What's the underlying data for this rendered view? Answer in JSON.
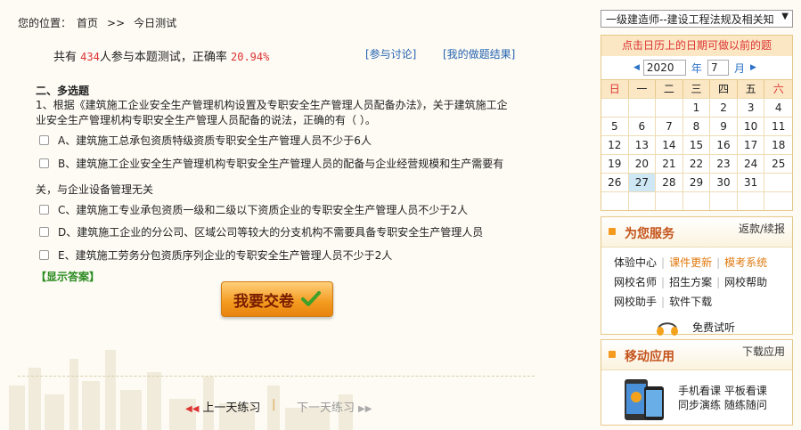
{
  "breadcrumb": {
    "prefix": "您的位置：",
    "home": "首页",
    "sep": ">>",
    "current": "今日测试"
  },
  "stats": {
    "part1": "共有",
    "count": "434",
    "part2": "人参与本题测试，正确率",
    "rate": "20.94%"
  },
  "links": {
    "discuss": "[参与讨论]",
    "result": "[我的做题结果]"
  },
  "question": {
    "section": "二、多选题",
    "text": "1、根据《建筑施工企业安全生产管理机构设置及专职安全生产管理人员配备办法》，关于建筑施工企业安全生产管理机构专职安全生产管理人员配备的说法，正确的有（   ）。",
    "options": [
      "A、建筑施工总承包资质特级资质专职安全生产管理人员不少于6人",
      "B、建筑施工企业安全生产管理机构专职安全生产管理人员的配备与企业经营规模和生产需要有",
      "C、建筑施工专业承包资质一级和二级以下资质企业的专职安全生产管理人员不少于2人",
      "D、建筑施工企业的分公司、区域公司等较大的分支机构不需要具备专职安全生产管理人员",
      "E、建筑施工劳务分包资质序列企业的专职安全生产管理人员不少于2人"
    ],
    "option_b_wrap": "关，与企业设备管理无关",
    "show_answer": "【显示答案】"
  },
  "submit": {
    "label": "我要交卷"
  },
  "nav": {
    "prev": "上一天练习",
    "pipe": "|",
    "next": "下一天练习"
  },
  "sidebar": {
    "course_select": "一级建造师--建设工程法规及相关知",
    "calendar": {
      "notice": "点击日历上的日期可做以前的题",
      "year": "2020",
      "year_unit": "年",
      "month": "7",
      "month_unit": "月",
      "weekdays": [
        "日",
        "一",
        "二",
        "三",
        "四",
        "五",
        "六"
      ],
      "weeks": [
        [
          "",
          "",
          "",
          "1",
          "2",
          "3",
          "4"
        ],
        [
          "5",
          "6",
          "7",
          "8",
          "9",
          "10",
          "11"
        ],
        [
          "12",
          "13",
          "14",
          "15",
          "16",
          "17",
          "18"
        ],
        [
          "19",
          "20",
          "21",
          "22",
          "23",
          "24",
          "25"
        ],
        [
          "26",
          "27",
          "28",
          "29",
          "30",
          "31",
          ""
        ],
        [
          "",
          "",
          "",
          "",
          "",
          "",
          ""
        ]
      ],
      "today": "27"
    },
    "services": {
      "title": "为您服务",
      "side": "返款/续报",
      "rows": [
        [
          "体验中心",
          "课件更新",
          "模考系统"
        ],
        [
          "网校名师",
          "招生方案",
          "网校帮助"
        ],
        [
          "网校助手",
          "软件下载"
        ]
      ],
      "highlight": [
        "课件更新",
        "模考系统"
      ],
      "free_trial": "免费试听"
    },
    "mobile": {
      "title": "移动应用",
      "side": "下载应用",
      "line1": "手机看课  平板看课",
      "line2": "同步演练  随练随问"
    }
  }
}
